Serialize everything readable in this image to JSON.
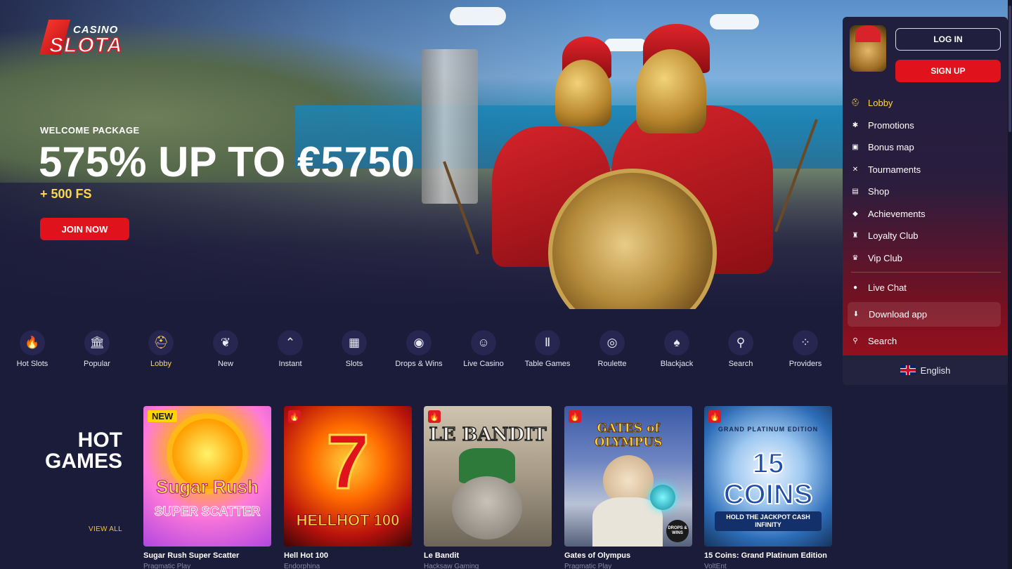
{
  "brand": {
    "top": "CASINO",
    "bottom": "SLOTA"
  },
  "hero": {
    "kicker": "WELCOME PACKAGE",
    "headline": "575% UP TO €5750",
    "subline": "+ 500 FS",
    "cta": "JOIN NOW"
  },
  "auth": {
    "login": "LOG IN",
    "signup": "SIGN UP"
  },
  "sidebar": {
    "items": [
      {
        "label": "Lobby",
        "icon": "helmet-icon"
      },
      {
        "label": "Promotions",
        "icon": "promotions-icon"
      },
      {
        "label": "Bonus map",
        "icon": "gift-icon"
      },
      {
        "label": "Tournaments",
        "icon": "swords-icon"
      },
      {
        "label": "Shop",
        "icon": "shop-icon"
      },
      {
        "label": "Achievements",
        "icon": "ticket-icon"
      },
      {
        "label": "Loyalty Club",
        "icon": "trophy-icon"
      },
      {
        "label": "Vip Club",
        "icon": "crown-icon"
      }
    ],
    "support": [
      {
        "label": "Live Chat",
        "icon": "chat-icon"
      },
      {
        "label": "Download app",
        "icon": "download-icon"
      },
      {
        "label": "Search",
        "icon": "search-icon"
      }
    ],
    "language": "English"
  },
  "categories": [
    {
      "label": "Hot Slots",
      "icon": "torch-icon"
    },
    {
      "label": "Popular",
      "icon": "colosseum-icon"
    },
    {
      "label": "Lobby",
      "icon": "helmet-icon"
    },
    {
      "label": "New",
      "icon": "laurel-icon"
    },
    {
      "label": "Instant",
      "icon": "instant-icon"
    },
    {
      "label": "Slots",
      "icon": "slot-machine-icon"
    },
    {
      "label": "Drops & Wins",
      "icon": "drops-wins-icon"
    },
    {
      "label": "Live Casino",
      "icon": "masks-icon"
    },
    {
      "label": "Table Games",
      "icon": "pillar-icon"
    },
    {
      "label": "Roulette",
      "icon": "roulette-icon"
    },
    {
      "label": "Blackjack",
      "icon": "cards-icon"
    },
    {
      "label": "Search",
      "icon": "search-icon"
    },
    {
      "label": "Providers",
      "icon": "grid-icon"
    }
  ],
  "hot_games": {
    "title_line1": "HOT",
    "title_line2": "GAMES",
    "view_all": "VIEW ALL",
    "games": [
      {
        "name": "Sugar Rush Super Scatter",
        "provider": "Pragmatic Play",
        "badge": "NEW",
        "art_top": "Sugar Rush",
        "art_bottom": "SUPER SCATTER"
      },
      {
        "name": "Hell Hot 100",
        "provider": "Endorphina",
        "badge": "hot",
        "art_top": "7",
        "art_bottom": "HELLHOT 100"
      },
      {
        "name": "Le Bandit",
        "provider": "Hacksaw Gaming",
        "badge": "hot",
        "art_top": "LE BANDIT",
        "art_bottom": ""
      },
      {
        "name": "Gates of Olympus",
        "provider": "Pragmatic Play",
        "badge": "hot",
        "art_top": "GATES of OLYMPUS",
        "art_bottom": "DROPS & WINS"
      },
      {
        "name": "15 Coins: Grand Platinum Edition",
        "provider": "VoltEnt",
        "badge": "hot",
        "art_top": "GRAND PLATINUM EDITION",
        "art_mid": "15 COINS",
        "art_bottom": "HOLD THE JACKPOT CASH INFINITY"
      }
    ]
  },
  "colors": {
    "accent": "#e0121b",
    "highlight": "#ffd84a",
    "bg": "#1b1b3a"
  }
}
